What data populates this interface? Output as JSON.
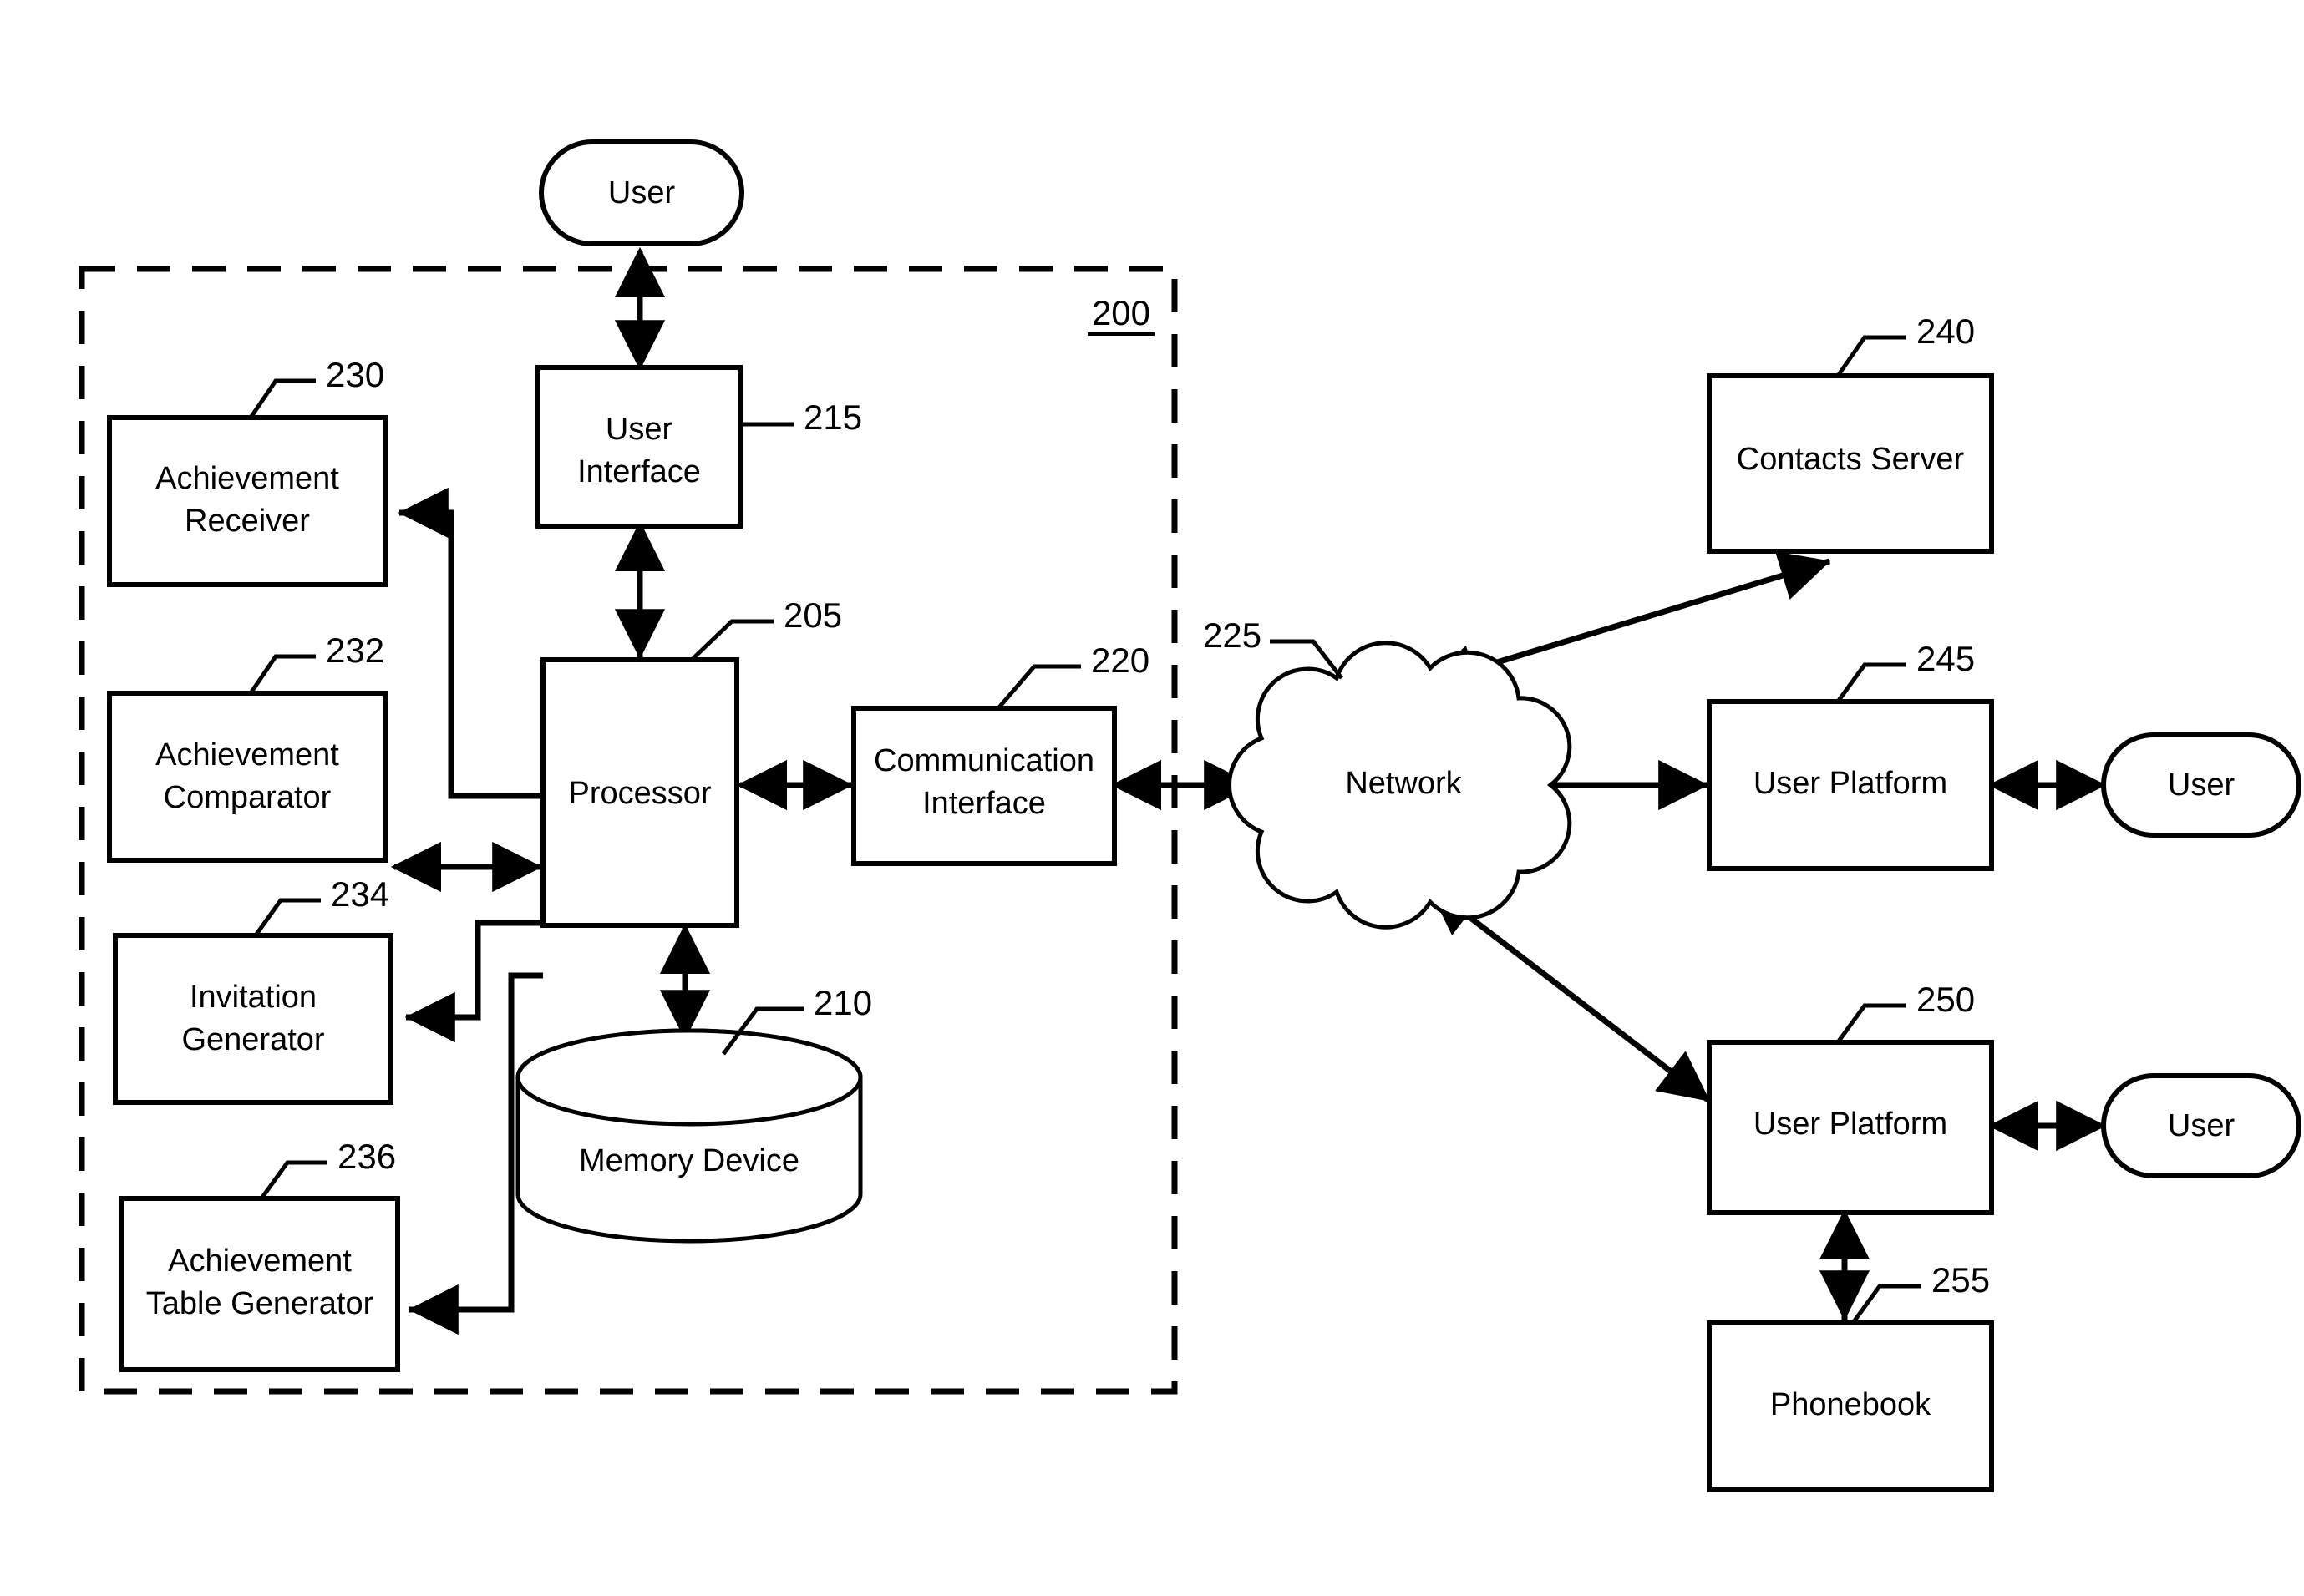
{
  "figure": {
    "system_ref": "200",
    "type": "patent-block-diagram"
  },
  "actors": {
    "user_top": "User",
    "user_right_upper": "User",
    "user_right_lower": "User"
  },
  "system_blocks": [
    {
      "id": "processor",
      "label": "Processor",
      "ref": "205"
    },
    {
      "id": "memory",
      "label": "Memory Device",
      "ref": "210"
    },
    {
      "id": "user_interface",
      "label": "User\nInterface",
      "ref": "215"
    },
    {
      "id": "comm_interface",
      "label": "Communication\nInterface",
      "ref": "220"
    },
    {
      "id": "ach_receiver",
      "label": "Achievement\nReceiver",
      "ref": "230"
    },
    {
      "id": "ach_comparator",
      "label": "Achievement\nComparator",
      "ref": "232"
    },
    {
      "id": "inv_generator",
      "label": "Invitation\nGenerator",
      "ref": "234"
    },
    {
      "id": "ach_table_gen",
      "label": "Achievement\nTable Generator",
      "ref": "236"
    }
  ],
  "labels": {
    "processor_l1": "Processor",
    "memory_l1": "Memory Device",
    "user_interface_l1": "User",
    "user_interface_l2": "Interface",
    "comm_interface_l1": "Communication",
    "comm_interface_l2": "Interface",
    "ach_receiver_l1": "Achievement",
    "ach_receiver_l2": "Receiver",
    "ach_comparator_l1": "Achievement",
    "ach_comparator_l2": "Comparator",
    "inv_generator_l1": "Invitation",
    "inv_generator_l2": "Generator",
    "ach_table_gen_l1": "Achievement",
    "ach_table_gen_l2": "Table Generator",
    "network": "Network",
    "contacts_server": "Contacts Server",
    "user_platform_upper": "User Platform",
    "user_platform_lower": "User Platform",
    "phonebook": "Phonebook"
  },
  "refs": {
    "system": "200",
    "processor": "205",
    "memory": "210",
    "user_interface": "215",
    "comm_interface": "220",
    "network": "225",
    "ach_receiver": "230",
    "ach_comparator": "232",
    "inv_generator": "234",
    "ach_table_gen": "236",
    "contacts_server": "240",
    "user_platform_upper": "245",
    "user_platform_lower": "250",
    "phonebook": "255"
  },
  "colors": {
    "stroke": "#000000",
    "fill": "#ffffff",
    "background": "#ffffff"
  }
}
